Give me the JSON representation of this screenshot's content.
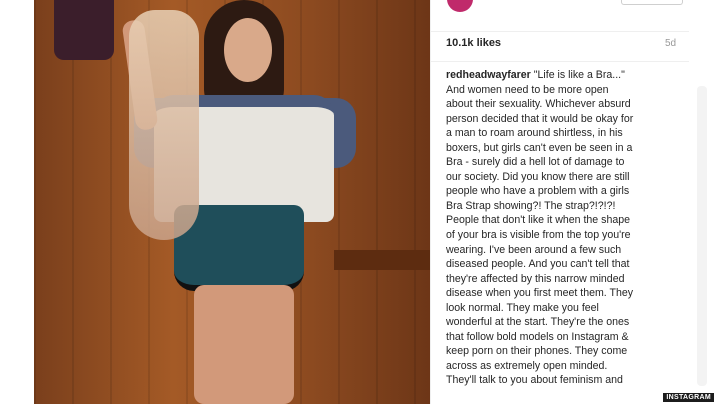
{
  "post": {
    "likes": "10.1k likes",
    "age": "5d",
    "caption_lines": [
      {
        "user": "redheadwayfarer",
        "text": " \"Life is like a Bra...\""
      },
      {
        "text": "And women need to be more open"
      },
      {
        "text": "about their sexuality. Whichever absurd"
      },
      {
        "text": "person decided that it would be okay for"
      },
      {
        "text": "a man to roam around shirtless, in his"
      },
      {
        "text": "boxers, but girls can't even be seen in a"
      },
      {
        "text": "Bra - surely did a hell lot of damage to"
      },
      {
        "text": "our society. Did you know there are still"
      },
      {
        "text": "people who have a problem with a girls"
      },
      {
        "text": "Bra Strap showing?! The strap?!?!?!"
      },
      {
        "text": "People that don't like it when the shape"
      },
      {
        "text": "of your bra is visible from the top you're"
      },
      {
        "text": "wearing. I've been around a few such"
      },
      {
        "text": "diseased people. And you can't tell that"
      },
      {
        "text": "they're affected by this narrow minded"
      },
      {
        "text": "disease when you first meet them. They"
      },
      {
        "text": "look normal. They make you feel"
      },
      {
        "text": "wonderful at the start. They're the ones"
      },
      {
        "text": "that follow bold models on Instagram &"
      },
      {
        "text": "keep porn on their phones. They come"
      },
      {
        "text": "across as extremely open minded."
      },
      {
        "text": "They'll talk to you about feminism and"
      }
    ]
  },
  "watermark": "INSTAGRAM",
  "colors": {
    "avatar": "#c02a6b",
    "text": "#262626",
    "muted": "#999999"
  }
}
